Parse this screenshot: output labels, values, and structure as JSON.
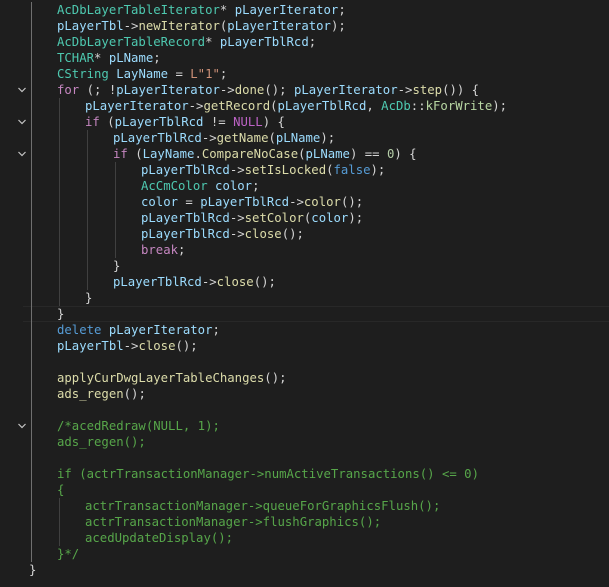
{
  "editor": {
    "lines": [
      {
        "indent": 1,
        "fold": false,
        "tokens": [
          [
            "type",
            "AcDbLayerTableIterator"
          ],
          [
            "txt",
            "* "
          ],
          [
            "var",
            "pLayerIterator"
          ],
          [
            "txt",
            ";"
          ]
        ]
      },
      {
        "indent": 1,
        "fold": false,
        "tokens": [
          [
            "var",
            "pLayerTbl"
          ],
          [
            "txt",
            "->"
          ],
          [
            "fn",
            "newIterator"
          ],
          [
            "txt",
            "("
          ],
          [
            "var",
            "pLayerIterator"
          ],
          [
            "txt",
            ");"
          ]
        ]
      },
      {
        "indent": 1,
        "fold": false,
        "tokens": [
          [
            "type",
            "AcDbLayerTableRecord"
          ],
          [
            "txt",
            "* "
          ],
          [
            "var",
            "pLayerTblRcd"
          ],
          [
            "txt",
            ";"
          ]
        ]
      },
      {
        "indent": 1,
        "fold": false,
        "tokens": [
          [
            "type",
            "TCHAR"
          ],
          [
            "txt",
            "* "
          ],
          [
            "var",
            "pLName"
          ],
          [
            "txt",
            ";"
          ]
        ]
      },
      {
        "indent": 1,
        "fold": false,
        "tokens": [
          [
            "type",
            "CString"
          ],
          [
            "txt",
            " "
          ],
          [
            "var",
            "LayName"
          ],
          [
            "txt",
            " = "
          ],
          [
            "str",
            "L\"1\""
          ],
          [
            "txt",
            ";"
          ]
        ]
      },
      {
        "indent": 1,
        "fold": true,
        "tokens": [
          [
            "ctl",
            "for"
          ],
          [
            "txt",
            " (; !"
          ],
          [
            "var",
            "pLayerIterator"
          ],
          [
            "txt",
            "->"
          ],
          [
            "fn",
            "done"
          ],
          [
            "txt",
            "(); "
          ],
          [
            "var",
            "pLayerIterator"
          ],
          [
            "txt",
            "->"
          ],
          [
            "fn",
            "step"
          ],
          [
            "txt",
            "()) {"
          ]
        ]
      },
      {
        "indent": 2,
        "fold": false,
        "tokens": [
          [
            "var",
            "pLayerIterator"
          ],
          [
            "txt",
            "->"
          ],
          [
            "fn",
            "getRecord"
          ],
          [
            "txt",
            "("
          ],
          [
            "var",
            "pLayerTblRcd"
          ],
          [
            "txt",
            ", "
          ],
          [
            "type",
            "AcDb"
          ],
          [
            "txt",
            "::"
          ],
          [
            "enum",
            "kForWrite"
          ],
          [
            "txt",
            ");"
          ]
        ]
      },
      {
        "indent": 2,
        "fold": true,
        "tokens": [
          [
            "ctl",
            "if"
          ],
          [
            "txt",
            " ("
          ],
          [
            "var",
            "pLayerTblRcd"
          ],
          [
            "txt",
            " != "
          ],
          [
            "mac",
            "NULL"
          ],
          [
            "txt",
            ") {"
          ]
        ]
      },
      {
        "indent": 3,
        "fold": false,
        "tokens": [
          [
            "var",
            "pLayerTblRcd"
          ],
          [
            "txt",
            "->"
          ],
          [
            "fn",
            "getName"
          ],
          [
            "txt",
            "("
          ],
          [
            "var",
            "pLName"
          ],
          [
            "txt",
            ");"
          ]
        ]
      },
      {
        "indent": 3,
        "fold": true,
        "tokens": [
          [
            "ctl",
            "if"
          ],
          [
            "txt",
            " ("
          ],
          [
            "var",
            "LayName"
          ],
          [
            "txt",
            "."
          ],
          [
            "fn",
            "CompareNoCase"
          ],
          [
            "txt",
            "("
          ],
          [
            "var",
            "pLName"
          ],
          [
            "txt",
            ") == "
          ],
          [
            "num",
            "0"
          ],
          [
            "txt",
            ") {"
          ]
        ]
      },
      {
        "indent": 4,
        "fold": false,
        "tokens": [
          [
            "var",
            "pLayerTblRcd"
          ],
          [
            "txt",
            "->"
          ],
          [
            "fn",
            "setIsLocked"
          ],
          [
            "txt",
            "("
          ],
          [
            "kw",
            "false"
          ],
          [
            "txt",
            ");"
          ]
        ]
      },
      {
        "indent": 4,
        "fold": false,
        "tokens": [
          [
            "type",
            "AcCmColor"
          ],
          [
            "txt",
            " "
          ],
          [
            "var",
            "color"
          ],
          [
            "txt",
            ";"
          ]
        ]
      },
      {
        "indent": 4,
        "fold": false,
        "tokens": [
          [
            "var",
            "color"
          ],
          [
            "txt",
            " = "
          ],
          [
            "var",
            "pLayerTblRcd"
          ],
          [
            "txt",
            "->"
          ],
          [
            "fn",
            "color"
          ],
          [
            "txt",
            "();"
          ]
        ]
      },
      {
        "indent": 4,
        "fold": false,
        "tokens": [
          [
            "var",
            "pLayerTblRcd"
          ],
          [
            "txt",
            "->"
          ],
          [
            "fn",
            "setColor"
          ],
          [
            "txt",
            "("
          ],
          [
            "var",
            "color"
          ],
          [
            "txt",
            ");"
          ]
        ]
      },
      {
        "indent": 4,
        "fold": false,
        "tokens": [
          [
            "var",
            "pLayerTblRcd"
          ],
          [
            "txt",
            "->"
          ],
          [
            "fn",
            "close"
          ],
          [
            "txt",
            "();"
          ]
        ]
      },
      {
        "indent": 4,
        "fold": false,
        "tokens": [
          [
            "ctl",
            "break"
          ],
          [
            "txt",
            ";"
          ]
        ]
      },
      {
        "indent": 3,
        "fold": false,
        "tokens": [
          [
            "txt",
            "}"
          ]
        ]
      },
      {
        "indent": 3,
        "fold": false,
        "tokens": [
          [
            "var",
            "pLayerTblRcd"
          ],
          [
            "txt",
            "->"
          ],
          [
            "fn",
            "close"
          ],
          [
            "txt",
            "();"
          ]
        ]
      },
      {
        "indent": 2,
        "fold": false,
        "tokens": [
          [
            "txt",
            "}"
          ]
        ]
      },
      {
        "indent": 1,
        "fold": false,
        "current": true,
        "tokens": [
          [
            "txt",
            "}"
          ]
        ]
      },
      {
        "indent": 1,
        "fold": false,
        "tokens": [
          [
            "kw",
            "delete"
          ],
          [
            "txt",
            " "
          ],
          [
            "var",
            "pLayerIterator"
          ],
          [
            "txt",
            ";"
          ]
        ]
      },
      {
        "indent": 1,
        "fold": false,
        "tokens": [
          [
            "var",
            "pLayerTbl"
          ],
          [
            "txt",
            "->"
          ],
          [
            "fn",
            "close"
          ],
          [
            "txt",
            "();"
          ]
        ]
      },
      {
        "indent": 1,
        "fold": false,
        "tokens": []
      },
      {
        "indent": 1,
        "fold": false,
        "tokens": [
          [
            "fn",
            "applyCurDwgLayerTableChanges"
          ],
          [
            "txt",
            "();"
          ]
        ]
      },
      {
        "indent": 1,
        "fold": false,
        "tokens": [
          [
            "fn",
            "ads_regen"
          ],
          [
            "txt",
            "();"
          ]
        ]
      },
      {
        "indent": 1,
        "fold": false,
        "tokens": []
      },
      {
        "indent": 1,
        "fold": true,
        "tokens": [
          [
            "cmt",
            "/*acedRedraw(NULL, 1);"
          ]
        ]
      },
      {
        "indent": 1,
        "fold": false,
        "tokens": [
          [
            "cmt",
            "ads_regen();"
          ]
        ]
      },
      {
        "indent": 1,
        "fold": false,
        "tokens": []
      },
      {
        "indent": 1,
        "fold": false,
        "tokens": [
          [
            "cmt",
            "if (actrTransactionManager->numActiveTransactions() <= 0)"
          ]
        ]
      },
      {
        "indent": 1,
        "fold": false,
        "tokens": [
          [
            "cmt",
            "{"
          ]
        ]
      },
      {
        "indent": 2,
        "fold": false,
        "tokens": [
          [
            "cmt",
            "actrTransactionManager->queueForGraphicsFlush();"
          ]
        ]
      },
      {
        "indent": 2,
        "fold": false,
        "tokens": [
          [
            "cmt",
            "actrTransactionManager->flushGraphics();"
          ]
        ]
      },
      {
        "indent": 2,
        "fold": false,
        "tokens": [
          [
            "cmt",
            "acedUpdateDisplay();"
          ]
        ]
      },
      {
        "indent": 1,
        "fold": false,
        "tokens": [
          [
            "cmt",
            "}*/"
          ]
        ]
      },
      {
        "indent": 0,
        "fold": false,
        "tokens": [
          [
            "txt",
            "}"
          ]
        ]
      }
    ]
  }
}
